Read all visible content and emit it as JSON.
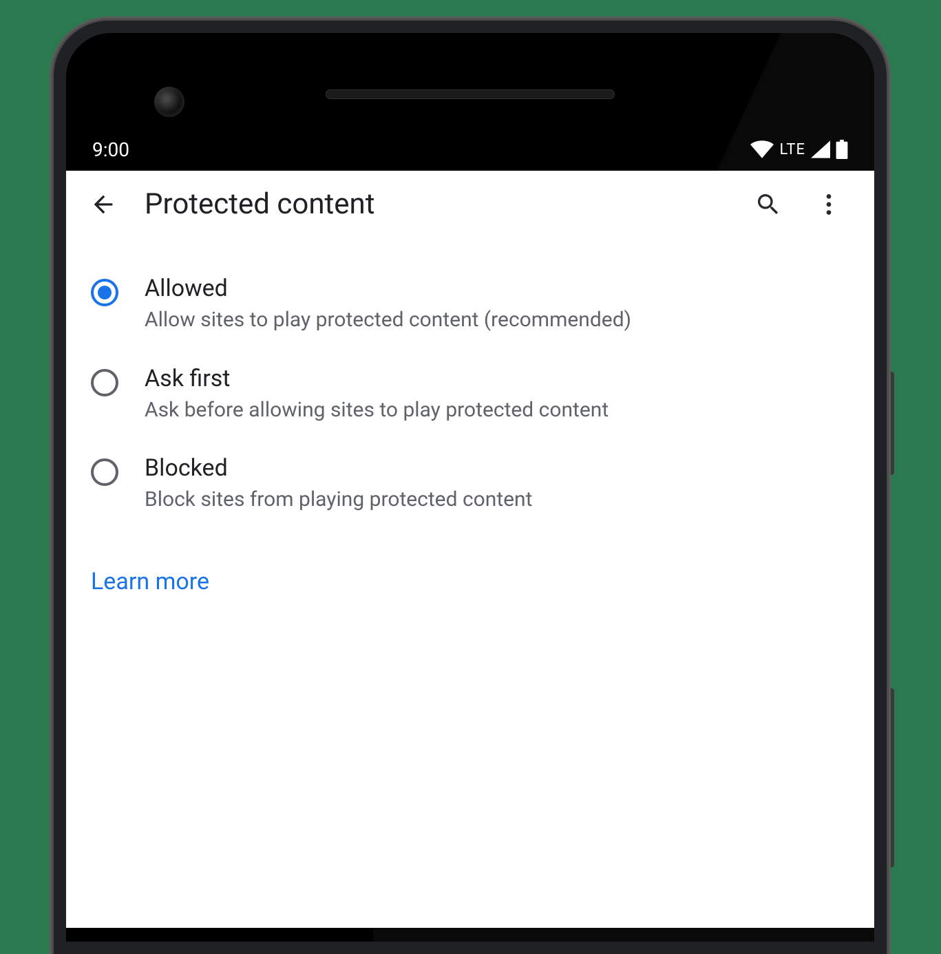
{
  "status_bar": {
    "time": "9:00",
    "network_label": "LTE"
  },
  "header": {
    "title": "Protected content"
  },
  "options": [
    {
      "id": "allowed",
      "title": "Allowed",
      "description": "Allow sites to play protected content (recommended)",
      "selected": true
    },
    {
      "id": "ask-first",
      "title": "Ask first",
      "description": "Ask before allowing sites to play protected content",
      "selected": false
    },
    {
      "id": "blocked",
      "title": "Blocked",
      "description": "Block sites from playing protected content",
      "selected": false
    }
  ],
  "learn_more_label": "Learn more",
  "colors": {
    "accent": "#1a73e8",
    "text_primary": "#202124",
    "text_secondary": "#5f6368"
  }
}
